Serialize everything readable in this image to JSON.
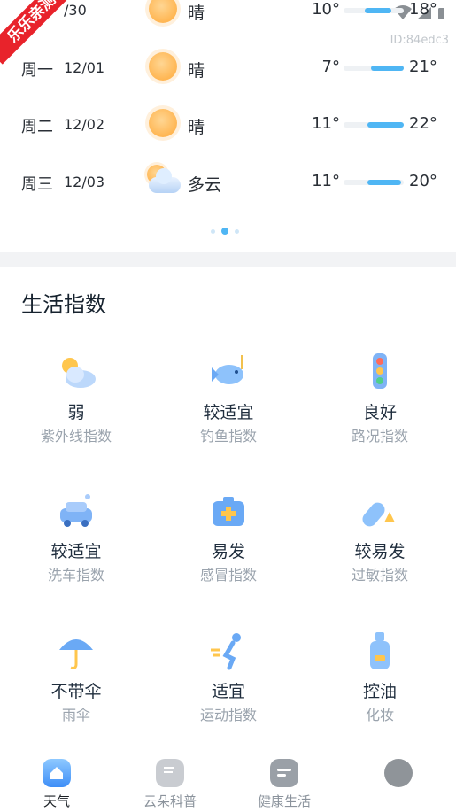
{
  "forecast": [
    {
      "day": "",
      "date": "/30",
      "icon": "sun-icon",
      "cond": "晴",
      "low": "10°",
      "high": "18°",
      "fill_start": 0.35,
      "fill_end": 0.8
    },
    {
      "day": "周一",
      "date": "12/01",
      "icon": "sun-icon",
      "cond": "晴",
      "low": "7°",
      "high": "21°",
      "fill_start": 0.45,
      "fill_end": 1.0
    },
    {
      "day": "周二",
      "date": "12/02",
      "icon": "sun-icon",
      "cond": "晴",
      "low": "11°",
      "high": "22°",
      "fill_start": 0.4,
      "fill_end": 1.0
    },
    {
      "day": "周三",
      "date": "12/03",
      "icon": "partly-cloudy-icon",
      "cond": "多云",
      "low": "11°",
      "high": "20°",
      "fill_start": 0.4,
      "fill_end": 0.95
    }
  ],
  "pager": {
    "count": 3,
    "active": 1
  },
  "life": {
    "title": "生活指数",
    "items": [
      {
        "value": "弱",
        "label": "紫外线指数",
        "icon": "uv-sun-cloud-icon"
      },
      {
        "value": "较适宜",
        "label": "钓鱼指数",
        "icon": "fish-icon"
      },
      {
        "value": "良好",
        "label": "路况指数",
        "icon": "traffic-light-icon"
      },
      {
        "value": "较适宜",
        "label": "洗车指数",
        "icon": "car-wash-icon"
      },
      {
        "value": "易发",
        "label": "感冒指数",
        "icon": "medical-kit-icon"
      },
      {
        "value": "较易发",
        "label": "过敏指数",
        "icon": "allergy-pill-icon"
      },
      {
        "value": "不带伞",
        "label": "雨伞",
        "icon": "umbrella-icon"
      },
      {
        "value": "适宜",
        "label": "运动指数",
        "icon": "runner-icon"
      },
      {
        "value": "控油",
        "label": "化妆",
        "icon": "cosmetic-bottle-icon"
      }
    ]
  },
  "tabs": [
    {
      "label": "天气",
      "icon": "home-weather-icon",
      "active": true
    },
    {
      "label": "云朵科普",
      "icon": "science-doc-icon",
      "active": false
    },
    {
      "label": "健康生活",
      "icon": "health-list-icon",
      "active": false
    },
    {
      "label": "",
      "icon": "profile-icon",
      "active": false
    }
  ],
  "badge": "乐乐亲测",
  "watermark": "ID:84edc3",
  "colors": {
    "accent": "#4fb6f4",
    "badge": "#e8232b",
    "sun": "#ffb653"
  }
}
